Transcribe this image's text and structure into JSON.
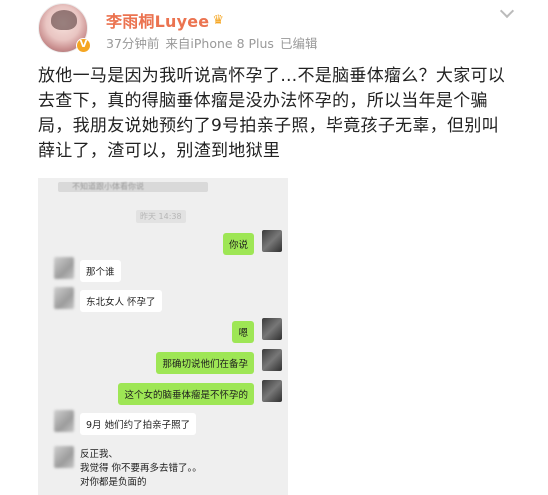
{
  "header": {
    "name": "李雨桐Luyee",
    "time": "37分钟前",
    "source": "来自iPhone 8 Plus",
    "edited": "已编辑"
  },
  "post": {
    "text": "放他一马是因为我听说高怀孕了…不是脑垂体瘤么？大家可以去查下，真的得脑垂体瘤是没办法怀孕的，所以当年是个骗局，我朋友说她预约了9号拍亲子照，毕竟孩子无辜，但别叫薛让了，渣可以，别渣到地狱里"
  },
  "chat": {
    "top_blur": "不知道跟小体看你说",
    "timestamp": "昨天 14:38",
    "messages": [
      {
        "side": "right",
        "text": "你说"
      },
      {
        "side": "left",
        "text": "那个谁"
      },
      {
        "side": "left",
        "text": "东北女人 怀孕了"
      },
      {
        "side": "right",
        "text": "嗯"
      },
      {
        "side": "right",
        "text": "那确切说他们在备孕"
      },
      {
        "side": "right",
        "text": "这个女的脑垂体瘤是不怀孕的"
      },
      {
        "side": "left",
        "text": "9月 她们约了拍亲子照了"
      }
    ],
    "bottom_lines": [
      "反正我、",
      "我觉得  你不要再多去错了。。",
      "对你都是负面的"
    ]
  }
}
